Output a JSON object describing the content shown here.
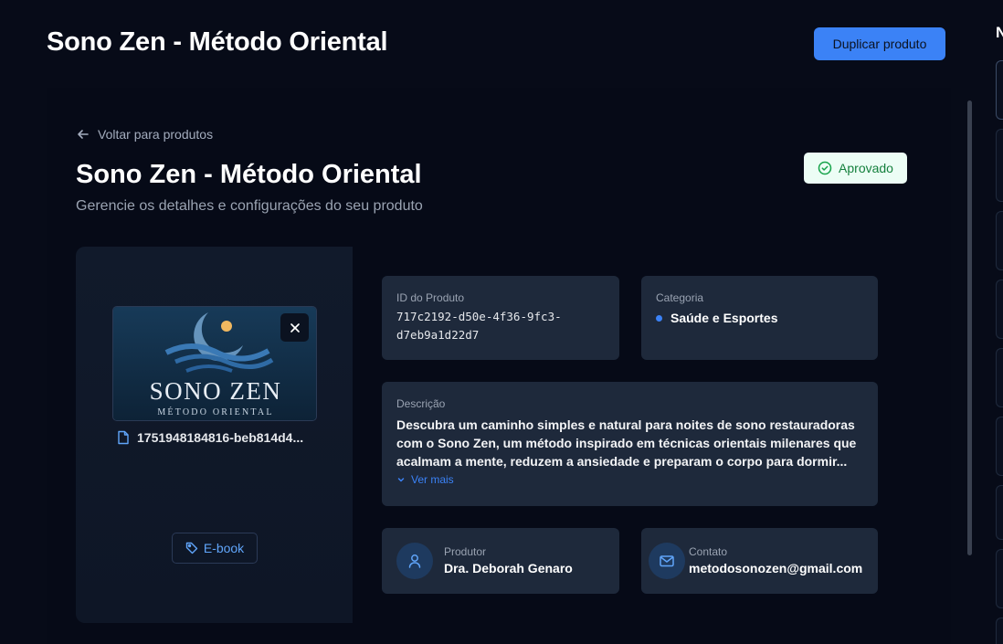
{
  "header": {
    "title": "Sono Zen - Método Oriental",
    "duplicate_label": "Duplicar produto",
    "right_letter": "N"
  },
  "page": {
    "back_label": "Voltar para produtos",
    "title": "Sono Zen - Método Oriental",
    "subtitle": "Gerencie os detalhes e configurações do seu produto",
    "status": "Aprovado"
  },
  "media": {
    "thumbnail_title": "SONO ZEN",
    "thumbnail_subtitle": "MÉTODO ORIENTAL",
    "file_name": "1751948184816-beb814d4...",
    "tag": "E-book"
  },
  "details": {
    "id_label": "ID do Produto",
    "id_value_line1": "717c2192-d50e-4f36-9fc3-",
    "id_value_line2": "d7eb9a1d22d7",
    "category_label": "Categoria",
    "category_value": "Saúde e Esportes",
    "description_label": "Descrição",
    "description_text": "Descubra um caminho simples e natural para noites de sono restauradoras com o Sono Zen, um método inspirado em técnicas orientais milenares que acalmam a mente, reduzem a ansiedade e preparam o corpo para dormir...",
    "see_more": "Ver mais",
    "producer_label": "Produtor",
    "producer_value": "Dra. Deborah Genaro",
    "contact_label": "Contato",
    "contact_value": "metodosonozen@gmail.com"
  },
  "colors": {
    "accent": "#3b82f6",
    "background": "#070b18",
    "card": "#1e293b",
    "success": "#15803d"
  }
}
